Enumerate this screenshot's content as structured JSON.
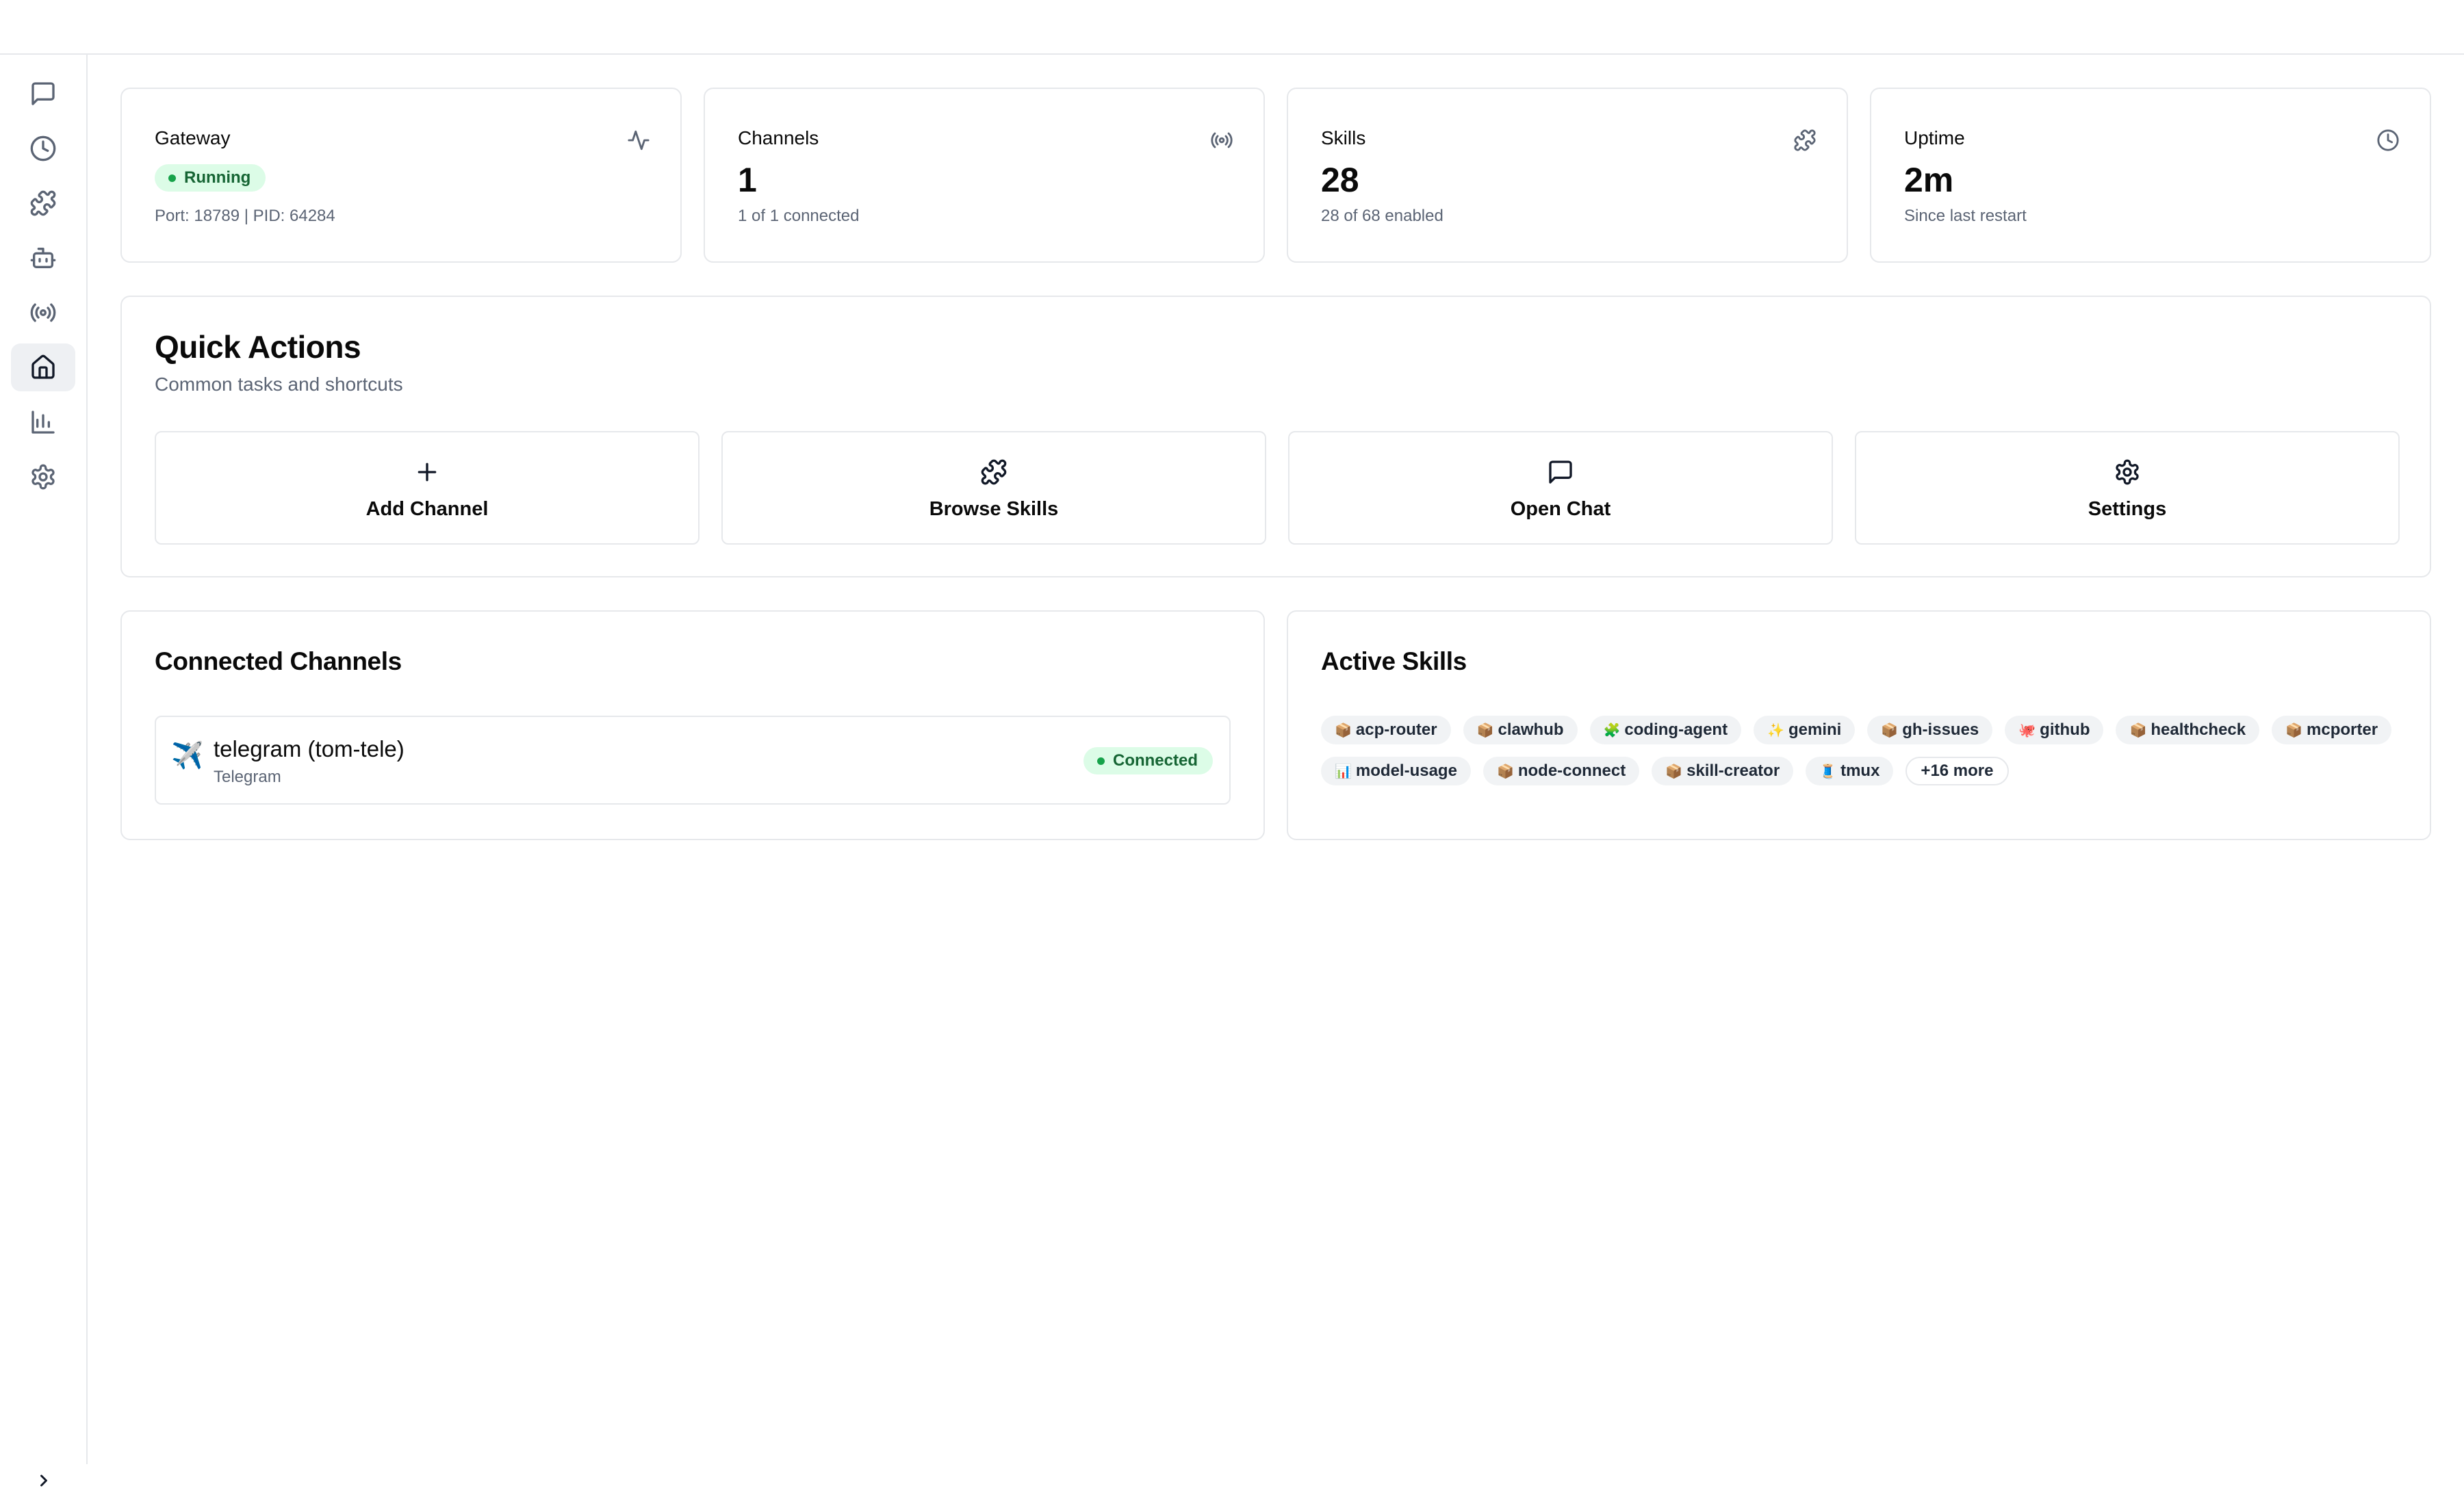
{
  "sidebar": {
    "items": [
      {
        "name": "chat",
        "icon": "message-square-icon"
      },
      {
        "name": "history",
        "icon": "clock-icon"
      },
      {
        "name": "skills",
        "icon": "puzzle-icon"
      },
      {
        "name": "agents",
        "icon": "bot-icon"
      },
      {
        "name": "channels",
        "icon": "radio-icon"
      },
      {
        "name": "home",
        "icon": "home-icon",
        "active": true
      },
      {
        "name": "usage",
        "icon": "bar-chart-icon"
      },
      {
        "name": "settings",
        "icon": "gear-icon"
      }
    ],
    "collapse_icon": "chevron-right-icon"
  },
  "stats": {
    "gateway": {
      "title": "Gateway",
      "status": "Running",
      "sub": "Port: 18789 | PID: 64284",
      "icon": "activity-icon"
    },
    "channels": {
      "title": "Channels",
      "value": "1",
      "sub": "1 of 1 connected",
      "icon": "radio-icon"
    },
    "skills": {
      "title": "Skills",
      "value": "28",
      "sub": "28 of 68 enabled",
      "icon": "puzzle-icon"
    },
    "uptime": {
      "title": "Uptime",
      "value": "2m",
      "sub": "Since last restart",
      "icon": "clock-icon"
    }
  },
  "quick_actions": {
    "title": "Quick Actions",
    "description": "Common tasks and shortcuts",
    "buttons": [
      {
        "label": "Add Channel",
        "icon": "plus-icon"
      },
      {
        "label": "Browse Skills",
        "icon": "puzzle-icon"
      },
      {
        "label": "Open Chat",
        "icon": "message-square-icon"
      },
      {
        "label": "Settings",
        "icon": "gear-icon"
      }
    ]
  },
  "connected_channels": {
    "title": "Connected Channels",
    "items": [
      {
        "emoji": "✈️",
        "name": "telegram (tom-tele)",
        "type": "Telegram",
        "status": "Connected"
      }
    ]
  },
  "active_skills": {
    "title": "Active Skills",
    "items": [
      {
        "emoji": "📦",
        "name": "acp-router"
      },
      {
        "emoji": "📦",
        "name": "clawhub"
      },
      {
        "emoji": "🧩",
        "name": "coding-agent"
      },
      {
        "emoji": "✨",
        "name": "gemini"
      },
      {
        "emoji": "📦",
        "name": "gh-issues"
      },
      {
        "emoji": "🐙",
        "name": "github"
      },
      {
        "emoji": "📦",
        "name": "healthcheck"
      },
      {
        "emoji": "📦",
        "name": "mcporter"
      },
      {
        "emoji": "📊",
        "name": "model-usage"
      },
      {
        "emoji": "📦",
        "name": "node-connect"
      },
      {
        "emoji": "📦",
        "name": "skill-creator"
      },
      {
        "emoji": "🧵",
        "name": "tmux"
      }
    ],
    "more_label": "+16 more"
  },
  "colors": {
    "accent_green_bg": "#dcfce7",
    "accent_green_text": "#166534",
    "status_dot": "#16a34a",
    "border": "#e6e8eb",
    "muted_text": "#5b6474"
  }
}
